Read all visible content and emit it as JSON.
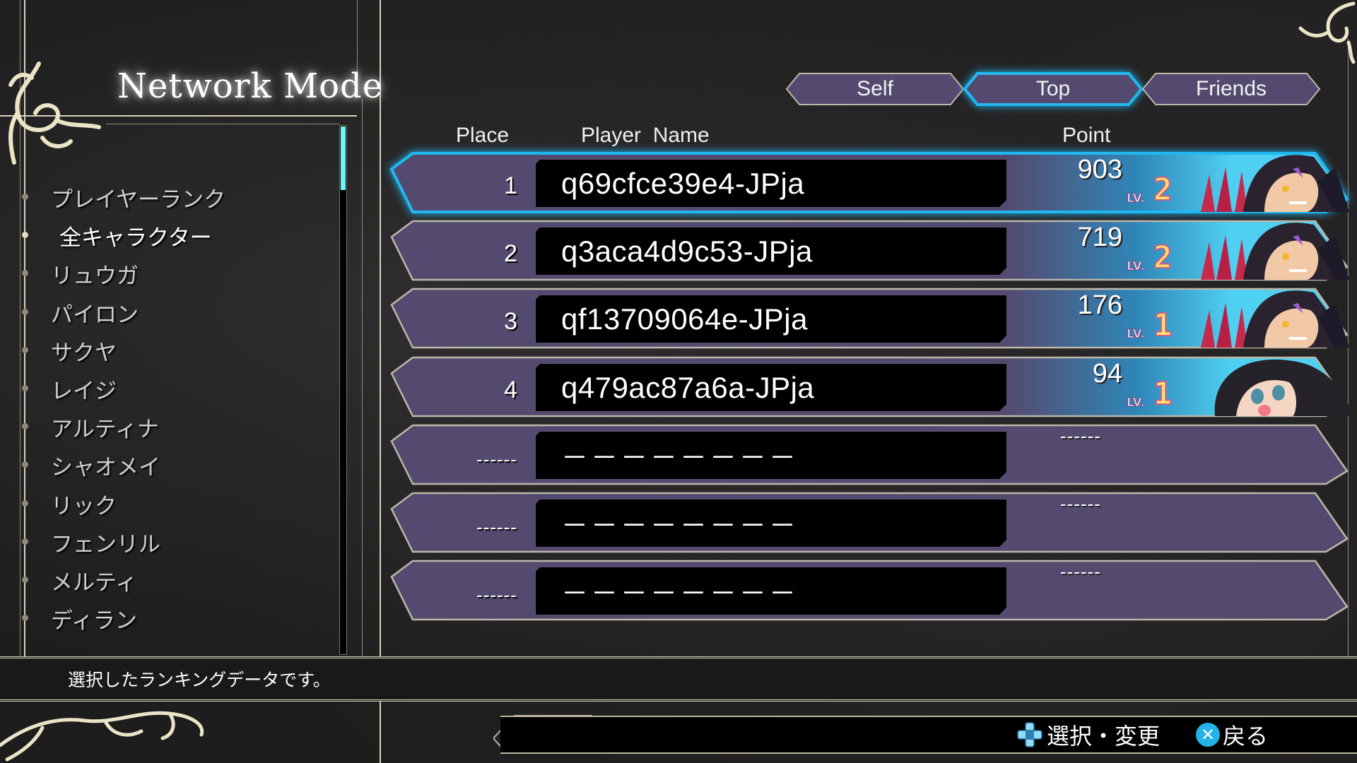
{
  "header": {
    "title": "Network Mode"
  },
  "sidebar": {
    "items": [
      {
        "label": "プレイヤーランク",
        "selected": false
      },
      {
        "label": "全キャラクター",
        "selected": true
      },
      {
        "label": "リュウガ",
        "selected": false
      },
      {
        "label": "パイロン",
        "selected": false
      },
      {
        "label": "サクヤ",
        "selected": false
      },
      {
        "label": "レイジ",
        "selected": false
      },
      {
        "label": "アルティナ",
        "selected": false
      },
      {
        "label": "シャオメイ",
        "selected": false
      },
      {
        "label": "リック",
        "selected": false
      },
      {
        "label": "フェンリル",
        "selected": false
      },
      {
        "label": "メルティ",
        "selected": false
      },
      {
        "label": "ディラン",
        "selected": false
      }
    ],
    "scroll_position_fraction": 0.0,
    "scroll_visible_fraction": 0.12
  },
  "tabs": [
    {
      "label": "Self",
      "active": false
    },
    {
      "label": "Top",
      "active": true
    },
    {
      "label": "Friends",
      "active": false
    }
  ],
  "table": {
    "headers": {
      "place": "Place",
      "player_name": "Player  Name",
      "point": "Point"
    },
    "level_prefix": "LV.",
    "rows": [
      {
        "place": "1",
        "name": "q69cfce39e4-JPja",
        "points": "903",
        "level": "2",
        "character": "male-character-portrait",
        "selected": true
      },
      {
        "place": "2",
        "name": "q3aca4d9c53-JPja",
        "points": "719",
        "level": "2",
        "character": "male-character-portrait",
        "selected": false
      },
      {
        "place": "3",
        "name": "qf13709064e-JPja",
        "points": "176",
        "level": "1",
        "character": "male-character-portrait",
        "selected": false
      },
      {
        "place": "4",
        "name": "q479ac87a6a-JPja",
        "points": "94",
        "level": "1",
        "character": "female-character-portrait",
        "selected": false
      },
      {
        "place": "------",
        "name": "－－－－－－－－",
        "points": "------",
        "level": null,
        "character": null,
        "selected": false
      },
      {
        "place": "------",
        "name": "－－－－－－－－",
        "points": "------",
        "level": null,
        "character": null,
        "selected": false
      },
      {
        "place": "------",
        "name": "－－－－－－－－",
        "points": "------",
        "level": null,
        "character": null,
        "selected": false
      }
    ]
  },
  "status": {
    "message": "選択したランキングデータです。"
  },
  "hints": [
    {
      "icon": "dpad-icon",
      "label": "選択・変更"
    },
    {
      "icon": "cross-button-icon",
      "label": "戻る"
    }
  ],
  "colors": {
    "row_fill": "#544a70",
    "row_border": "#bdb7a8",
    "selected_glow": "#20b8f0",
    "point_gradient_end": "#4fd0f2",
    "frame_gold": "#d8d2b8",
    "scroll_thumb": "#6ff4fb"
  }
}
